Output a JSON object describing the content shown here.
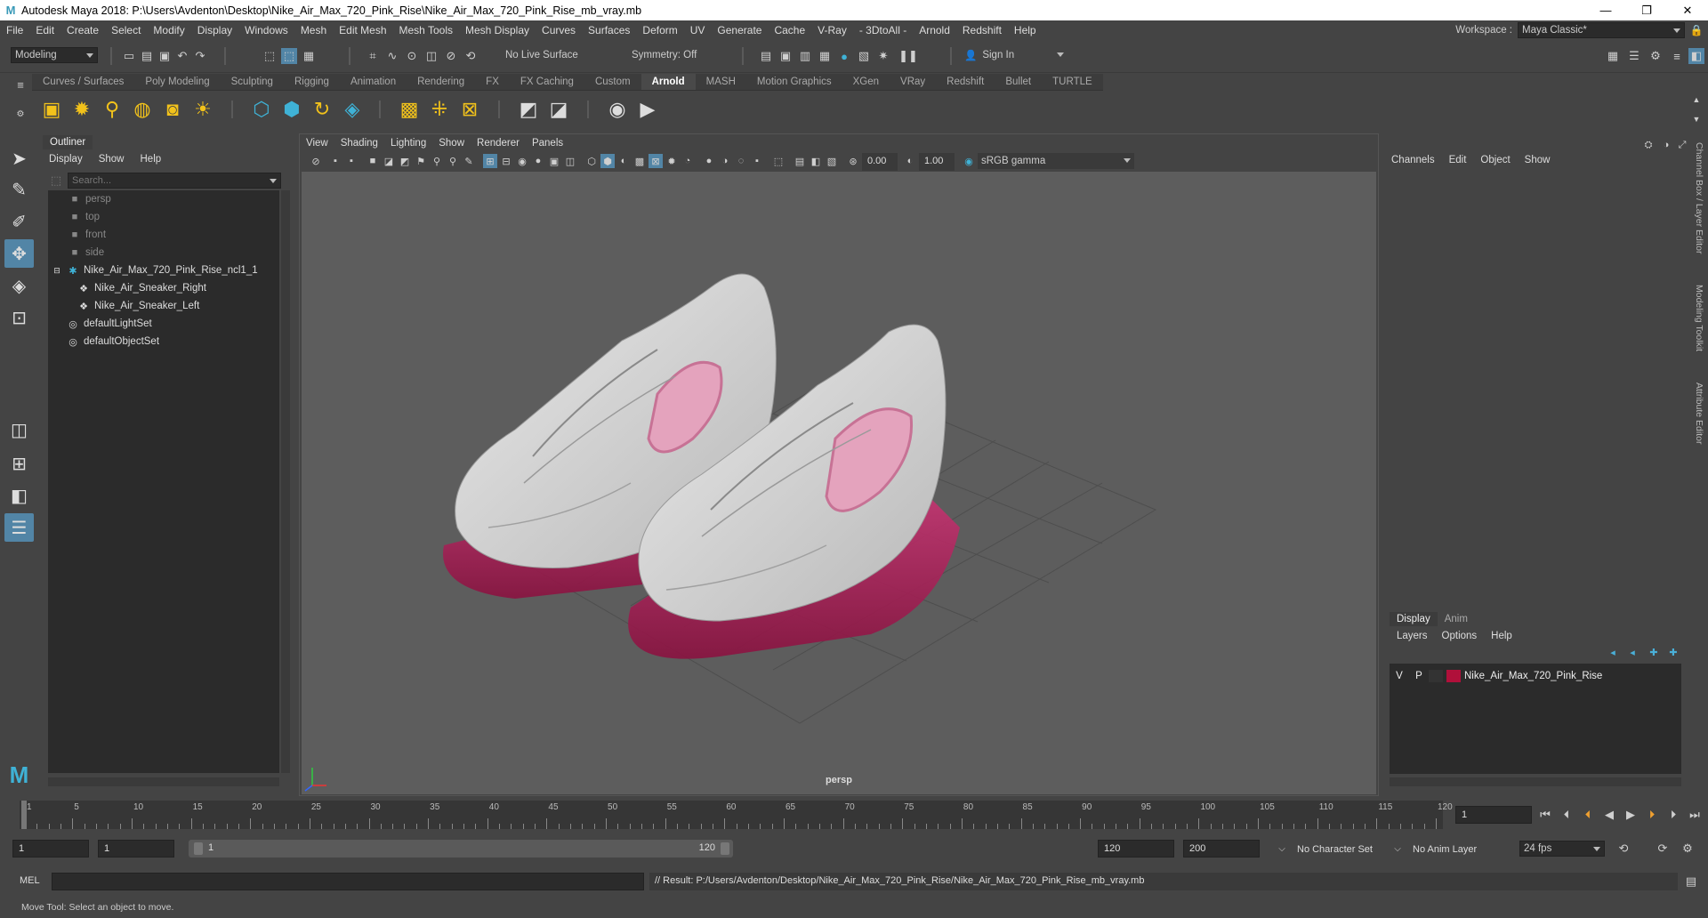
{
  "window": {
    "title": "Autodesk Maya 2018: P:\\Users\\Avdenton\\Desktop\\Nike_Air_Max_720_Pink_Rise\\Nike_Air_Max_720_Pink_Rise_mb_vray.mb",
    "minimize": "—",
    "maximize": "❐",
    "close": "✕"
  },
  "menubar": {
    "items": [
      "File",
      "Edit",
      "Create",
      "Select",
      "Modify",
      "Display",
      "Windows",
      "Mesh",
      "Edit Mesh",
      "Mesh Tools",
      "Mesh Display",
      "Curves",
      "Surfaces",
      "Deform",
      "UV",
      "Generate",
      "Cache",
      "V-Ray",
      "- 3DtoAll -",
      "Arnold",
      "Redshift",
      "Help"
    ],
    "workspace_label": "Workspace :",
    "workspace_value": "Maya Classic*"
  },
  "statusline": {
    "mode": "Modeling",
    "live_surface": "No Live Surface",
    "symmetry": "Symmetry: Off",
    "sign_in": "Sign In"
  },
  "shelf": {
    "tabs": [
      "Curves / Surfaces",
      "Poly Modeling",
      "Sculpting",
      "Rigging",
      "Animation",
      "Rendering",
      "FX",
      "FX Caching",
      "Custom",
      "Arnold",
      "MASH",
      "Motion Graphics",
      "XGen",
      "VRay",
      "Redshift",
      "Bullet",
      "TURTLE"
    ],
    "active_tab": "Arnold"
  },
  "outliner": {
    "title": "Outliner",
    "menu": [
      "Display",
      "Show",
      "Help"
    ],
    "search_placeholder": "Search...",
    "items": [
      {
        "label": "persp",
        "dim": true
      },
      {
        "label": "top",
        "dim": true
      },
      {
        "label": "front",
        "dim": true
      },
      {
        "label": "side",
        "dim": true
      },
      {
        "label": "Nike_Air_Max_720_Pink_Rise_ncl1_1",
        "dim": false
      },
      {
        "label": "Nike_Air_Sneaker_Right",
        "dim": false
      },
      {
        "label": "Nike_Air_Sneaker_Left",
        "dim": false
      },
      {
        "label": "defaultLightSet",
        "dim": false
      },
      {
        "label": "defaultObjectSet",
        "dim": false
      }
    ]
  },
  "viewport": {
    "menu": [
      "View",
      "Shading",
      "Lighting",
      "Show",
      "Renderer",
      "Panels"
    ],
    "exposure": "0.00",
    "gamma": "1.00",
    "color_space": "sRGB gamma",
    "camera_label": "persp"
  },
  "channelbox": {
    "menu": [
      "Channels",
      "Edit",
      "Object",
      "Show"
    ],
    "layer_tabs": [
      "Display",
      "Anim"
    ],
    "layer_menu": [
      "Layers",
      "Options",
      "Help"
    ],
    "layer": {
      "v": "V",
      "p": "P",
      "name": "Nike_Air_Max_720_Pink_Rise",
      "color": "#b0103a"
    }
  },
  "sidetabs": [
    "Channel Box / Layer Editor",
    "Modeling Toolkit",
    "Attribute Editor"
  ],
  "timeline": {
    "ticks": [
      1,
      5,
      10,
      15,
      20,
      25,
      30,
      35,
      40,
      45,
      50,
      55,
      60,
      65,
      70,
      75,
      80,
      85,
      90,
      95,
      100,
      105,
      110,
      115,
      120
    ],
    "current_frame": "1"
  },
  "range": {
    "start": "1",
    "playback_start": "1",
    "slider_start": "1",
    "slider_end": "120",
    "playback_end": "120",
    "end": "200",
    "character_set": "No Character Set",
    "anim_layer": "No Anim Layer",
    "fps": "24 fps"
  },
  "command": {
    "lang": "MEL",
    "result": "// Result: P:/Users/Avdenton/Desktop/Nike_Air_Max_720_Pink_Rise/Nike_Air_Max_720_Pink_Rise_mb_vray.mb"
  },
  "helpline": {
    "text": "Move Tool: Select an object to move."
  }
}
